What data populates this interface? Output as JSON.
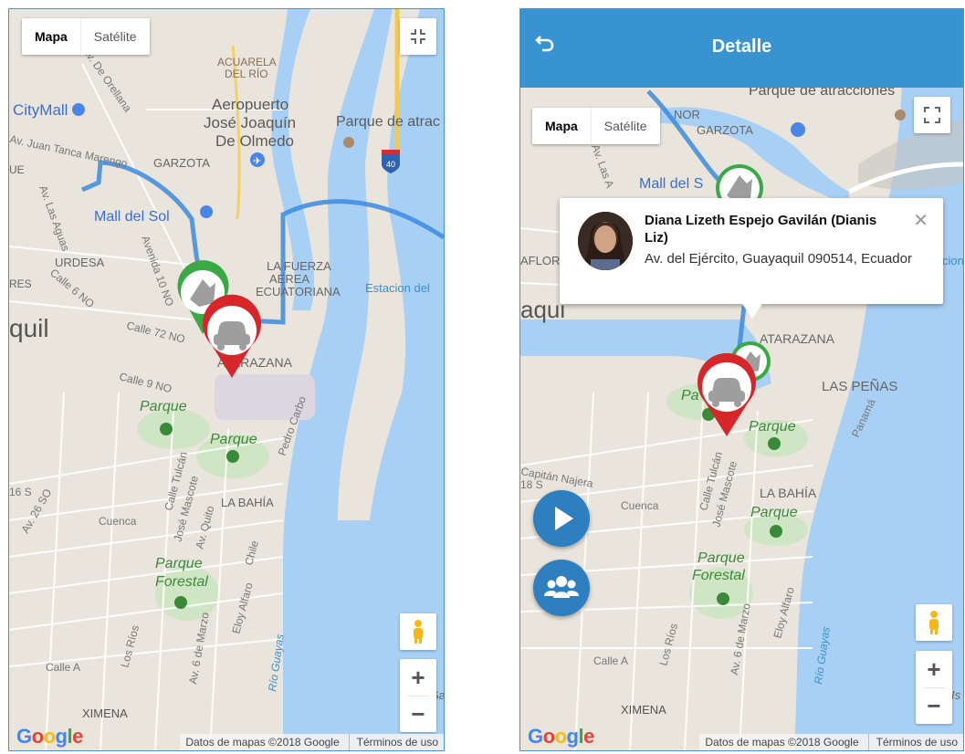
{
  "left_map": {
    "maptype": {
      "map_label": "Mapa",
      "satellite_label": "Satélite"
    },
    "labels": [
      "ACUARELA",
      "DEL RÍO",
      "Aeropuerto",
      "José Joaquín",
      "De Olmedo",
      "Parque de atrac",
      "CityMall",
      "Av. Juan Tanca Marengo",
      "GARZOTA",
      "Mall del Sol",
      "URDESA",
      "LA FUERZA",
      "AEREA",
      "ECUATORIANA",
      "Estacion del",
      "quil",
      "Calle 72 NO",
      "ATARAZANA",
      "Calle 9 NO",
      "Parque",
      "Parque",
      "Pedro Carbo",
      "LA BAHÍA",
      "Cuenca",
      "Calle Tulcán",
      "José Mascote",
      "Av. Quito",
      "Chile",
      "Parque",
      "Forestal",
      "Los Ríos",
      "Av. 6 de Marzo",
      "Eloy Alfaro",
      "Río Guayas",
      "Calle A",
      "XIMENA",
      "Av. Las Aguas",
      "Avenida 10 NO",
      "Calle 6 NO",
      "16 S",
      "Av. 26 SO",
      "Sa",
      "RES",
      "UE",
      "Av. De Orellana"
    ],
    "highway": "40"
  },
  "right_app": {
    "header": {
      "back_icon": "undo-arrow-icon",
      "title": "Detalle"
    },
    "maptype": {
      "map_label": "Mapa",
      "satellite_label": "Satélite"
    },
    "labels": [
      "Parque de atracciones",
      "GARZOTA",
      "Mall del S",
      "AFLORE",
      "cion",
      "aqui",
      "ATARAZANA",
      "LAS PEÑAS",
      "Pa",
      "Parque",
      "Panamá",
      "Capitán Najera",
      "18 S",
      "Calle Tulcán",
      "José Mascote",
      "Cuenca",
      "LA BAHÍA",
      "Parque",
      "Parque",
      "Forestal",
      "Eloy Alfaro",
      "Los Ríos",
      "Av. 6 de Marzo",
      "Río Guayas",
      "Calle A",
      "XIMENA",
      "Is",
      "NOR",
      "Av. Las A"
    ],
    "info_window": {
      "name": "Diana Lizeth Espejo Gavilán (Dianis Liz)",
      "address": "Av. del Ejército, Guayaquil 090514, Ecuador"
    },
    "fabs": {
      "play_icon": "play-icon",
      "group_icon": "group-icon"
    }
  },
  "footer": {
    "google": "Google",
    "map_data": "Datos de mapas ©2018 Google",
    "terms": "Términos de uso"
  },
  "colors": {
    "route": "#3b8be0",
    "marker_red": "#d7262a",
    "marker_green": "#3aa845",
    "header": "#3a93d1",
    "water": "#a8d0f5",
    "fab": "#2d7fc0"
  }
}
